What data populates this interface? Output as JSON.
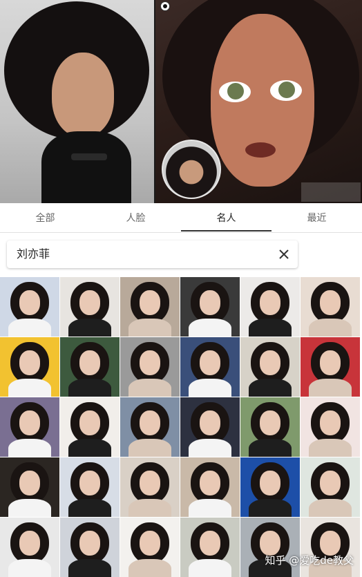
{
  "tabs": [
    {
      "label": "全部"
    },
    {
      "label": "人脸"
    },
    {
      "label": "名人"
    },
    {
      "label": "最近"
    }
  ],
  "active_tab": 2,
  "search": {
    "value": "刘亦菲"
  },
  "watermark": "知乎 @爱吃de教父",
  "grid": {
    "rows": 5,
    "cols": 6,
    "cell_backgrounds": [
      "#cfd8e6",
      "#e7e4e0",
      "#b8a99a",
      "#3a3a3a",
      "#eceae8",
      "#e8dcd2",
      "#f2c230",
      "#3d5a3e",
      "#9a9a9a",
      "#3a4f7a",
      "#d7d2c8",
      "#c8343a",
      "#7a6f92",
      "#f1eeea",
      "#7f8fa5",
      "#2d3140",
      "#7f9a6c",
      "#f1e4e2",
      "#2b2622",
      "#d7dde6",
      "#d9d0c6",
      "#c9b9a8",
      "#1d4fa8",
      "#dfe6e0",
      "#e8e8e8",
      "#cfd3da",
      "#f3f1ee",
      "#c9cbc2",
      "#aab0b6",
      "#e9e4df"
    ]
  }
}
